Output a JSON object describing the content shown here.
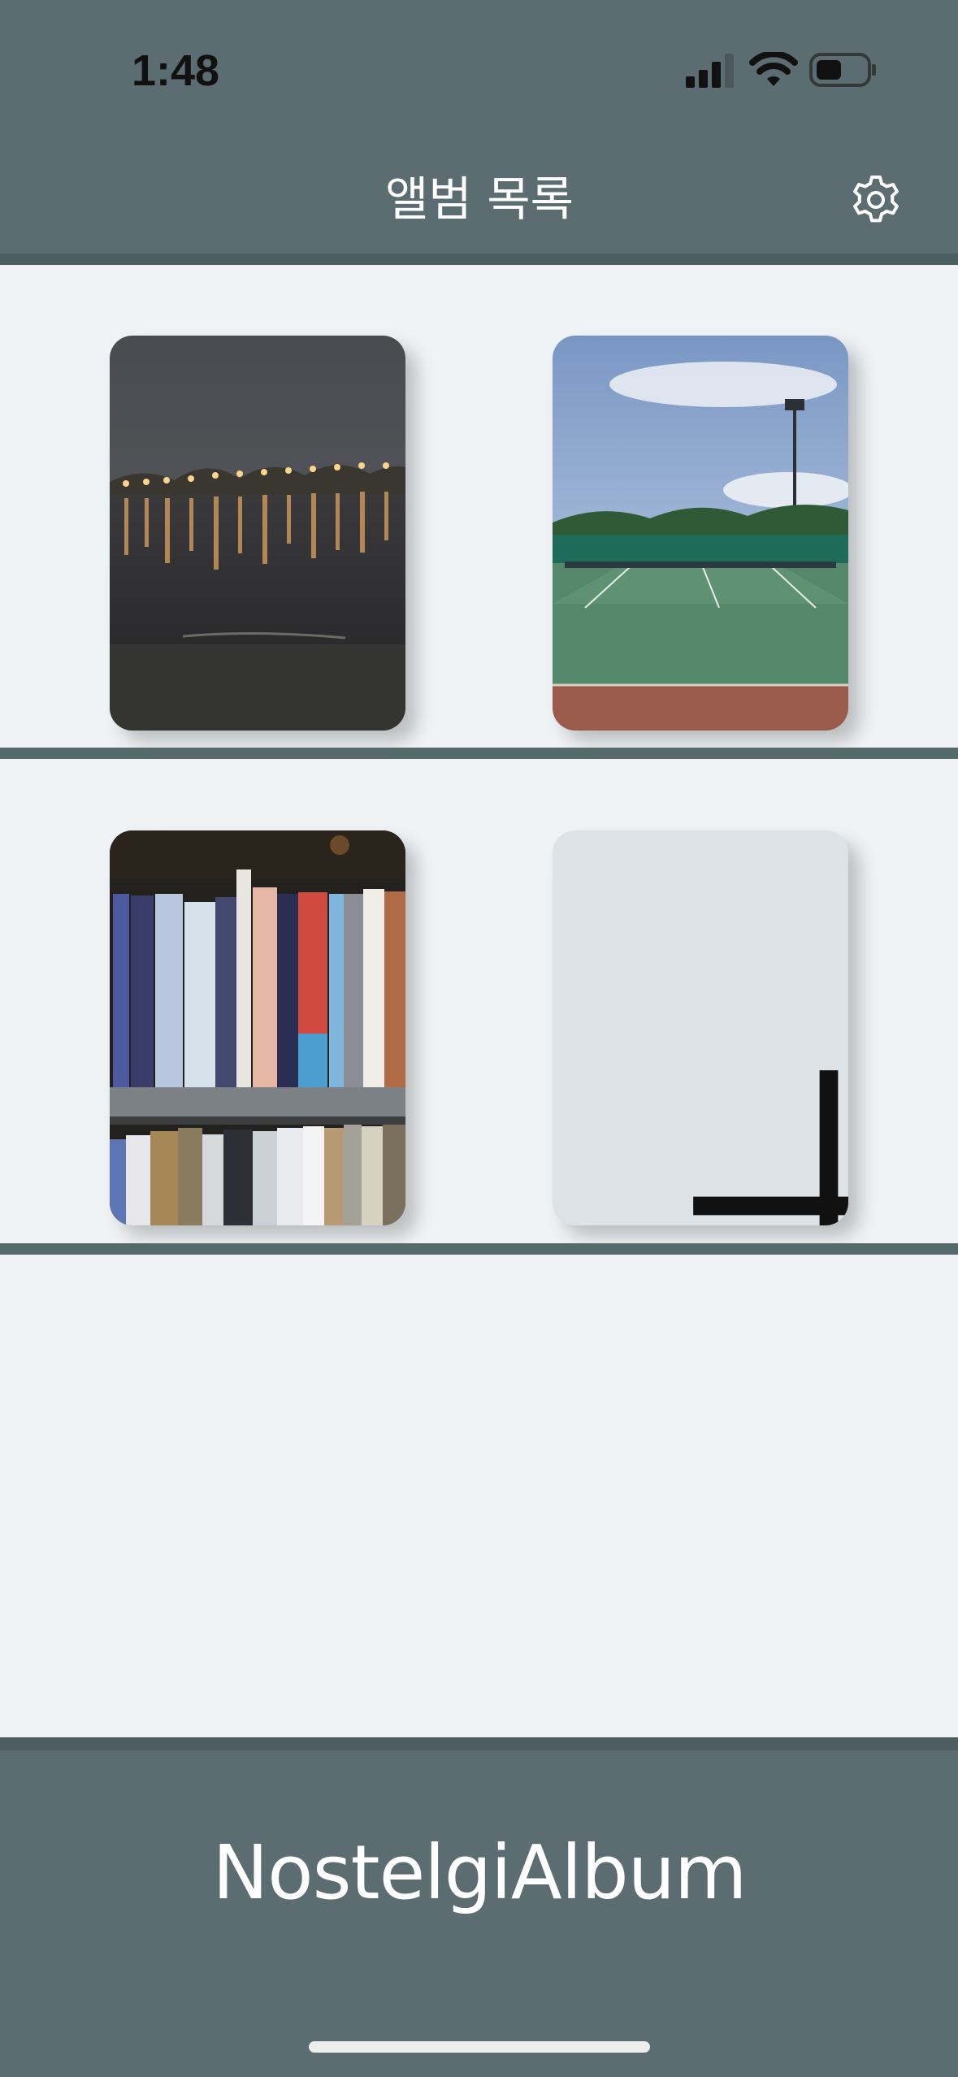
{
  "status_bar": {
    "time": "1:48",
    "signal_icon": "cellular-signal-icon",
    "wifi_icon": "wifi-icon",
    "battery_icon": "battery-icon"
  },
  "header": {
    "title": "앨범 목록",
    "settings_icon": "gear-icon"
  },
  "albums": [
    {
      "thumbnail": "night river bridge lights"
    },
    {
      "thumbnail": "tennis court under sky"
    },
    {
      "thumbnail": "bookshelf with books"
    }
  ],
  "add_album": {
    "icon": "plus-icon"
  },
  "footer": {
    "logo": "NostelgiAlbum"
  },
  "colors": {
    "header_bg": "#5b6d71",
    "page_bg": "#eff3f5",
    "add_card_bg": "#dde2e6",
    "divider": "#566a6e"
  }
}
